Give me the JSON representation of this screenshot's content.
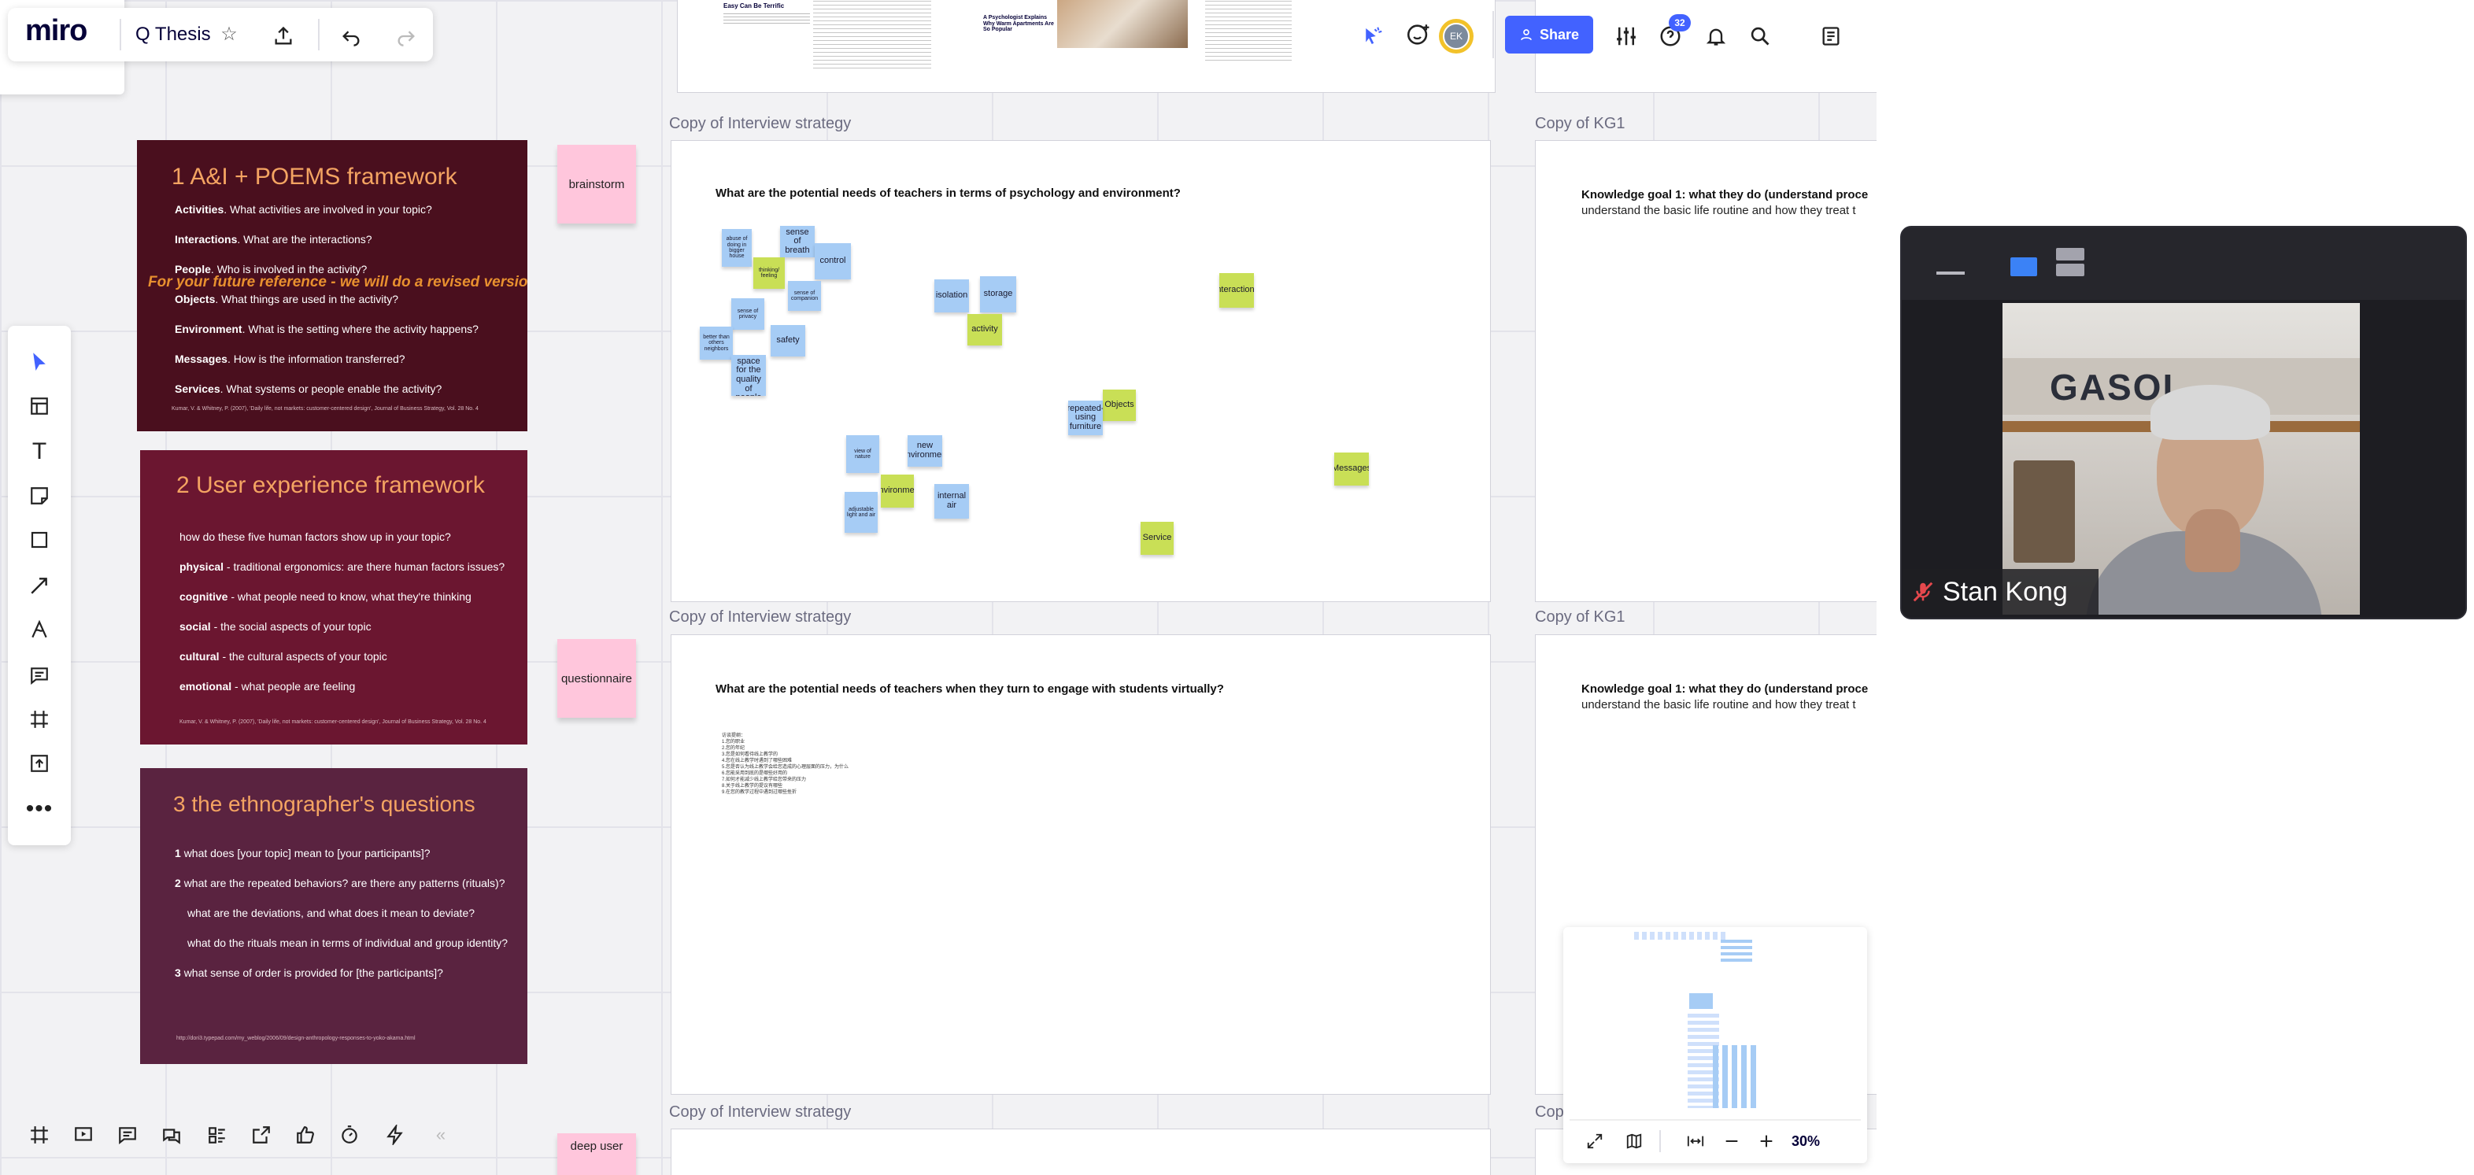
{
  "app": {
    "logo": "miro",
    "board_title": "Q Thesis",
    "avatar_initials": "EK",
    "share_label": "Share",
    "notification_count": "32",
    "zoom": "30%"
  },
  "colors": {
    "accent": "#4262ff",
    "slide1": "#4a0f1e",
    "slide2": "#6b1630",
    "slide3": "#5a2340",
    "slide_title": "#f4a462",
    "sticky_blue": "#a6ccf5",
    "sticky_green": "#c9df56",
    "sticky_pink": "#ffc6dc"
  },
  "frames": {
    "top_label": "Copy of Interview strategy",
    "label_interview": "Copy of Interview strategy",
    "label_kg": "Copy of KG1",
    "label_partial": "Cop",
    "q1": "What are the potential needs of teachers in terms of psychology and environment?",
    "q2": "What are the potential needs of teachers when they turn to engage with students virtually?",
    "kg_line1": "Knowledge goal 1: what they do (understand proce",
    "kg_line2": "understand the basic life routine and how they treat t",
    "q2_list": [
      "访谈提纲：",
      "1.您的职业",
      "2.您的年纪",
      "3.您是如何看待线上教学的",
      "4.您在线上教学时遇到了哪些困难",
      "5.您是否认为线上教学会给您造成的心理层面的压力，为什么",
      "6.您能采用到底的是哪些好用的",
      "7.如何才能减少线上教学给您带来的压力",
      "8.关于线上教学的提议有哪些",
      "9.在您的教学过程中遇到过哪些挫折"
    ]
  },
  "top_snippet": {
    "a": "Easy Can Be Terrific",
    "b": "A Psychologist Explains Why Warm Apartments Are So Popular"
  },
  "notes": {
    "brainstorm": "brainstorm",
    "questionnaire": "questionnaire",
    "deep": "deep user"
  },
  "stickies": [
    {
      "t": "abuse of doing in bigger house",
      "c": "blue"
    },
    {
      "t": "sense of breath",
      "c": "blue"
    },
    {
      "t": "control",
      "c": "blue"
    },
    {
      "t": "thinking/ feeling",
      "c": "green"
    },
    {
      "t": "sense of companion",
      "c": "blue"
    },
    {
      "t": "sense of privacy",
      "c": "blue"
    },
    {
      "t": "safety",
      "c": "blue"
    },
    {
      "t": "better than others neighbors",
      "c": "blue"
    },
    {
      "t": "a sense of space for the quality of people life",
      "c": "blue"
    },
    {
      "t": "isolation",
      "c": "blue"
    },
    {
      "t": "storage",
      "c": "blue"
    },
    {
      "t": "activity",
      "c": "green"
    },
    {
      "t": "interactions",
      "c": "green"
    },
    {
      "t": "Objects",
      "c": "green"
    },
    {
      "t": "repeated-using furniture",
      "c": "blue"
    },
    {
      "t": "view of nature",
      "c": "blue"
    },
    {
      "t": "new environment",
      "c": "blue"
    },
    {
      "t": "Environment",
      "c": "green"
    },
    {
      "t": "internal air",
      "c": "blue"
    },
    {
      "t": "adjustable light and air",
      "c": "blue"
    },
    {
      "t": "Messages",
      "c": "green"
    },
    {
      "t": "Service",
      "c": "green"
    }
  ],
  "slides": [
    {
      "title": "1  A&I + POEMS framework",
      "overlay": "For your future reference - we will do a revised version",
      "lines": [
        [
          "Activities",
          "What activities are involved in your topic?"
        ],
        [
          "Interactions",
          "What are the interactions?"
        ],
        [
          "People",
          "Who is involved in the activity?"
        ],
        [
          "Objects",
          "What things are used in the activity?"
        ],
        [
          "Environment",
          "What is the setting where the activity happens?"
        ],
        [
          "Messages",
          "How is the information transferred?"
        ],
        [
          "Services",
          "What systems or people enable the activity?"
        ]
      ],
      "note": "Kumar, V. & Whitney, P. (2007), 'Daily life, not markets: customer-centered design', Journal of Business Strategy, Vol. 28 No. 4"
    },
    {
      "title": "2  User experience framework",
      "intro": "how do these five human factors show up in your topic?",
      "lines": [
        [
          "physical",
          "- traditional ergonomics: are there human factors issues?"
        ],
        [
          "cognitive",
          "- what people need to know, what they're thinking"
        ],
        [
          "social",
          "- the social aspects of your topic"
        ],
        [
          "cultural",
          "- the cultural aspects of your topic"
        ],
        [
          "emotional",
          "- what people are feeling"
        ]
      ],
      "note": "Kumar, V. & Whitney, P. (2007), 'Daily life, not markets: customer-centered design', Journal of Business Strategy, Vol. 28 No. 4"
    },
    {
      "title": "3  the ethnographer's questions",
      "lines": [
        [
          "1",
          "what does [your topic] mean to [your participants]?"
        ],
        [
          "2",
          "what are the repeated behaviors? are there any patterns (rituals)?"
        ],
        [
          "",
          "what are the deviations, and what does it mean to deviate?"
        ],
        [
          "",
          "what do the rituals mean in terms of individual and group identity?"
        ],
        [
          "3",
          "what sense of order is provided for [the participants]?"
        ]
      ],
      "note": "http://dori3.typepad.com/my_weblog/2006/09/design-anthropology-responses-to-yoko-akama.html"
    }
  ],
  "video": {
    "name": "Stan Kong",
    "sign": "GASOL"
  }
}
